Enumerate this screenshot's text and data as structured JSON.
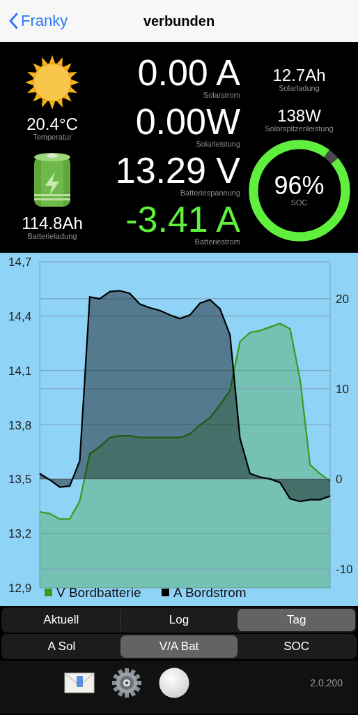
{
  "nav": {
    "back_label": "Franky",
    "title": "verbunden"
  },
  "dashboard": {
    "temperature": {
      "value": "20.4°C",
      "label": "Temperatur"
    },
    "battery_charge": {
      "value": "114.8Ah",
      "label": "Batterieladung"
    },
    "readings": [
      {
        "value": "0.00 A",
        "label": "Solarstrom",
        "color": "#ffffff"
      },
      {
        "value": "0.00W",
        "label": "Solarleistung",
        "color": "#ffffff"
      },
      {
        "value": "13.29 V",
        "label": "Batteriespannung",
        "color": "#ffffff"
      },
      {
        "value": "-3.41 A",
        "label": "Batteriestrom",
        "color": "#5ef03c"
      }
    ],
    "side": [
      {
        "value": "12.7Ah",
        "label": "Solarladung"
      },
      {
        "value": "138W",
        "label": "Solarspitzenleistung"
      }
    ],
    "soc": {
      "value": "96%",
      "label": "SOC",
      "level": 0.96
    }
  },
  "chart": {
    "layers": [
      {
        "chart_data": {
          "type": "area",
          "grid": true,
          "categories": [
            null,
            null,
            null,
            null,
            null,
            null,
            null,
            null,
            null,
            null,
            null,
            null,
            null,
            null,
            null,
            null,
            null,
            null,
            null,
            null,
            null,
            null,
            null,
            null,
            null,
            null,
            null,
            null,
            null,
            null
          ],
          "ylim": [
            12.9,
            14.7
          ],
          "yticks": [
            {
              "value": 12.9,
              "label": "12,9"
            },
            {
              "value": 13.2,
              "label": "13,2"
            },
            {
              "value": 13.5,
              "label": "13,5"
            },
            {
              "value": 13.8,
              "label": "13,8"
            },
            {
              "value": 14.1,
              "label": "14,1"
            },
            {
              "value": 14.4,
              "label": "14,4"
            },
            {
              "value": 14.7,
              "label": "14,7"
            }
          ],
          "series": [
            {
              "name": "V Bordbatterie",
              "color": "#3a9a1e",
              "values": [
                13.32,
                13.31,
                13.28,
                13.28,
                13.38,
                13.64,
                13.68,
                13.73,
                13.74,
                13.74,
                13.73,
                13.73,
                13.73,
                13.73,
                13.73,
                13.75,
                13.8,
                13.84,
                13.91,
                13.99,
                14.26,
                14.31,
                14.32,
                14.34,
                14.36,
                14.33,
                14.05,
                13.58,
                13.53,
                13.49
              ]
            }
          ]
        }
      },
      {
        "chart_data": {
          "type": "area",
          "grid": true,
          "categories": [
            null,
            null,
            null,
            null,
            null,
            null,
            null,
            null,
            null,
            null,
            null,
            null,
            null,
            null,
            null,
            null,
            null,
            null,
            null,
            null,
            null,
            null,
            null,
            null,
            null,
            null,
            null,
            null,
            null,
            null
          ],
          "ylim": [
            -12.1,
            24.1
          ],
          "yticks": [
            -10,
            0,
            10,
            20
          ],
          "series": [
            {
              "name": "A Bordstrom",
              "color": "#000000",
              "values": [
                0.6,
                -0.1,
                -0.9,
                -0.8,
                2,
                20.2,
                20.0,
                20.8,
                20.9,
                20.6,
                19.4,
                19.0,
                18.7,
                18.2,
                17.8,
                18.2,
                19.5,
                19.9,
                18.9,
                16,
                4.5,
                0.6,
                0.2,
                0.0,
                -0.4,
                -2.2,
                -2.5,
                -2.3,
                -2.3,
                -1.9
              ]
            }
          ]
        }
      }
    ]
  },
  "view_tabs": [
    {
      "label": "Aktuell",
      "selected": false
    },
    {
      "label": "Log",
      "selected": false
    },
    {
      "label": "Tag",
      "selected": true
    }
  ],
  "series_tabs": [
    {
      "label": "A Sol",
      "selected": false
    },
    {
      "label": "V/A Bat",
      "selected": true
    },
    {
      "label": "SOC",
      "selected": false
    }
  ],
  "toolbar": {
    "version": "2.0.200"
  }
}
